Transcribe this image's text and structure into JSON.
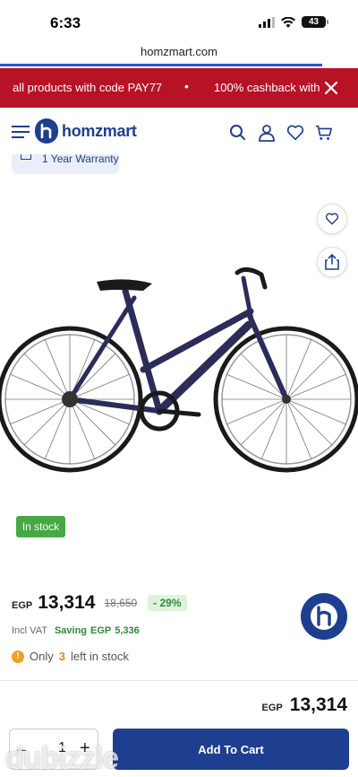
{
  "status_bar": {
    "time": "6:33",
    "battery": "43"
  },
  "browser": {
    "url": "homzmart.com"
  },
  "promo": {
    "text": "all products with code PAY77",
    "separator": "•",
    "text2": "100% cashback with"
  },
  "header": {
    "logo_text": "homzmart"
  },
  "product": {
    "warranty": "1 Year Warranty",
    "stock_badge": "In stock",
    "currency": "EGP",
    "price": "13,314",
    "old_price": "18,650",
    "discount": "- 29%",
    "vat": "Incl VAT",
    "saving_label": "Saving",
    "saving_currency": "EGP",
    "saving_value": "5,336",
    "only_prefix": "Only",
    "stock_count": "3",
    "only_suffix": "left in stock"
  },
  "cart": {
    "currency": "EGP",
    "price": "13,314",
    "quantity": "1",
    "minus": "–",
    "plus": "+",
    "add_label": "Add To Cart"
  },
  "watermark": "dubizzle",
  "colors": {
    "brand": "#1e3f8f",
    "promo": "#b81226",
    "stock": "#47a846",
    "discount": "#2f8a3a",
    "warn": "#f0a020"
  }
}
